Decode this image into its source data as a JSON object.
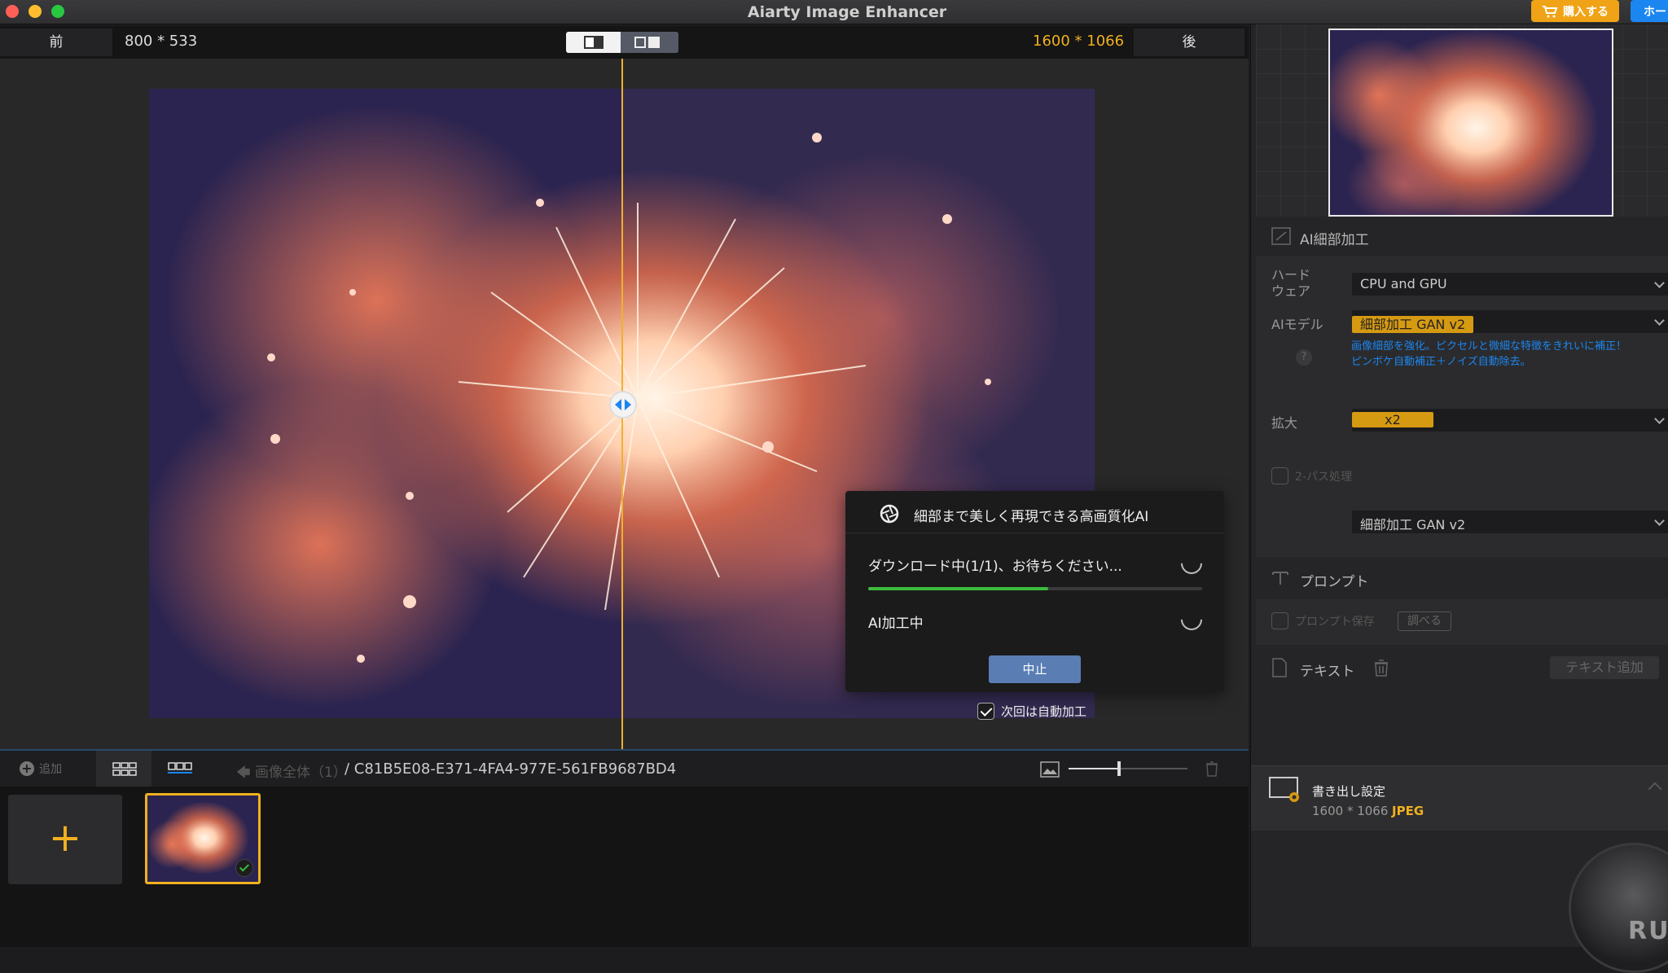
{
  "window": {
    "title": "Aiarty Image Enhancer",
    "buy_label": "購入する",
    "home_label": "ホー"
  },
  "compare": {
    "before_label": "前",
    "before_size": "800 * 533",
    "after_size": "1600 * 1066",
    "after_label": "後"
  },
  "dialog": {
    "title": "細部まで美しく再現できる高画質化AI",
    "download_text": "ダウンロード中(1/1)、お待ちください...",
    "download_progress": 0.54,
    "processing_text": "AI加工中",
    "stop_label": "中止",
    "auto_label": "次回は自動加工",
    "auto_checked": true
  },
  "bottombar": {
    "add_label": "追加",
    "all_images": "画像全体（1）",
    "path": "/ C81B5E08-E371-4FA4-977E-561FB9687BD4"
  },
  "panel": {
    "ai_detail_title": "AI細部加工",
    "hardware_label": "ハード\nウェア",
    "hardware_value": "CPU and GPU",
    "model_label": "AIモデル",
    "model_value": "細部加工 GAN v2",
    "model_desc_1": "画像細部を強化。ピクセルと微細な特徴をきれいに補正！",
    "model_desc_2": "ピンボケ自動補正＋ノイズ自動除去。",
    "scale_label": "拡大",
    "scale_value": "x2",
    "twopass_label": "2-パス処理",
    "twopass_model": "細部加工 GAN v2",
    "prompt_title": "プロンプト",
    "prompt_save_label": "プロンプト保存",
    "prompt_check_label": "調べる",
    "text_title": "テキスト",
    "text_add_label": "テキスト追加",
    "export_title": "書き出し設定",
    "export_size": "1600 * 1066",
    "export_format": "JPEG",
    "run_label": "RUN"
  }
}
